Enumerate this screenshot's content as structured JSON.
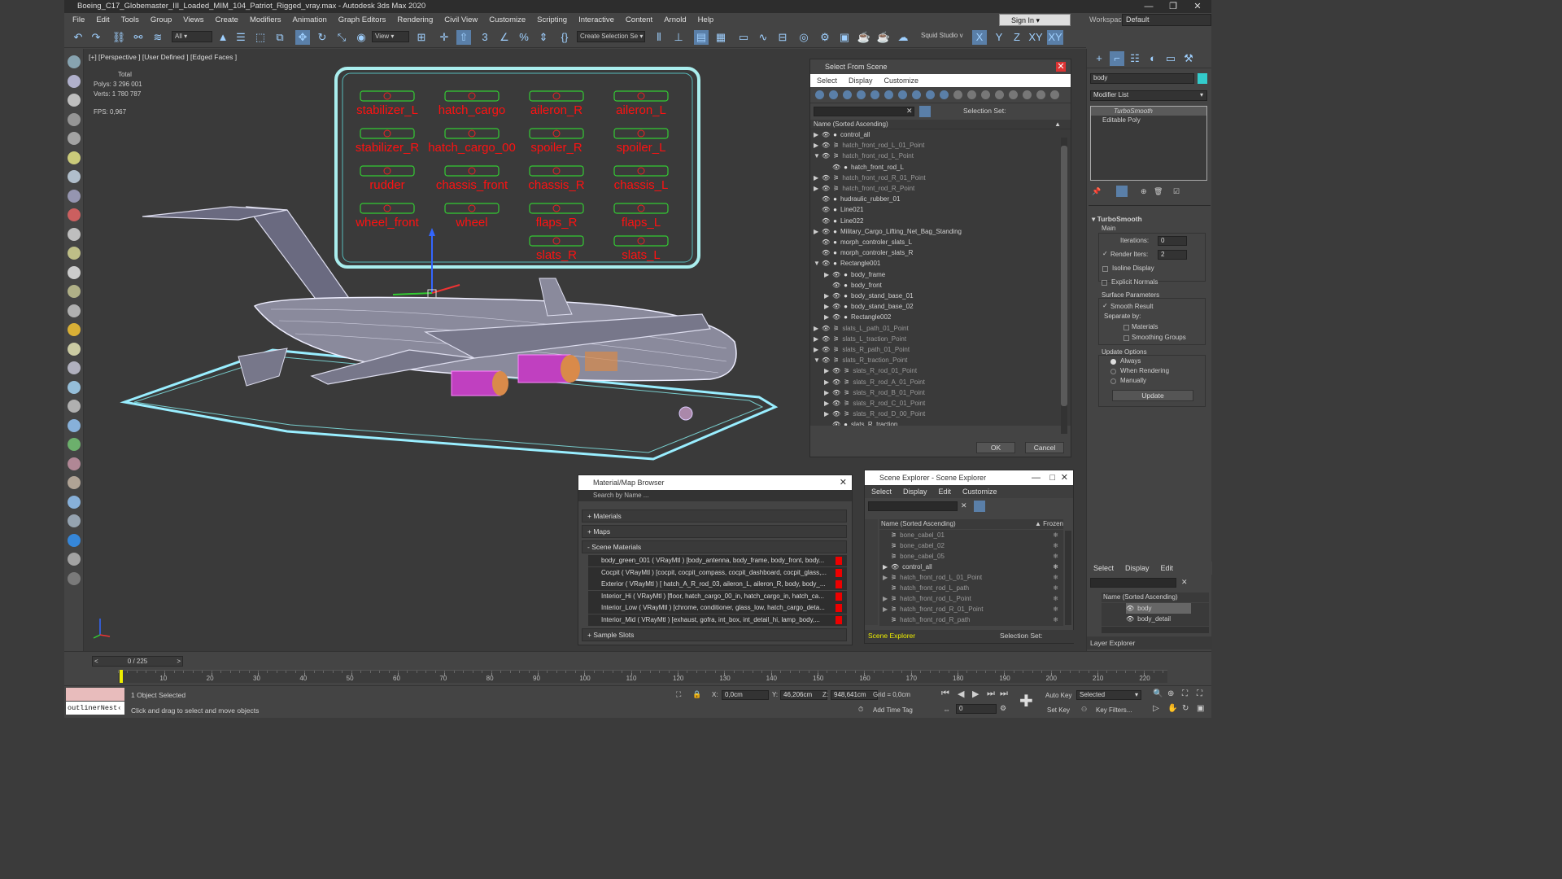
{
  "window": {
    "title": "Boeing_C17_Globemaster_III_Loaded_MIM_104_Patriot_Rigged_vray.max - Autodesk 3ds Max 2020",
    "min": "—",
    "max": "❐",
    "close": "✕"
  },
  "menu": [
    "File",
    "Edit",
    "Tools",
    "Group",
    "Views",
    "Create",
    "Modifiers",
    "Animation",
    "Graph Editors",
    "Rendering",
    "Civil View",
    "Customize",
    "Scripting",
    "Interactive",
    "Content",
    "Arnold",
    "Help"
  ],
  "signin": "Sign In",
  "workspace": {
    "label": "Workspaces:",
    "value": "Default"
  },
  "toolbar": {
    "filter": "All",
    "view": "View",
    "create_selection": "Create Selection Se",
    "squid": "Squid Studio v",
    "axes": [
      "X",
      "Y",
      "Z",
      "XY",
      "XY"
    ]
  },
  "viewport": {
    "label": "[+] [Perspective ] [User Defined ] [Edged Faces ]",
    "stats_total": "Total",
    "polys_label": "Polys:",
    "polys": "3 296 001",
    "verts_label": "Verts:",
    "verts": "1 780 787",
    "fps_label": "FPS:",
    "fps": "0,967",
    "controls": [
      "stabilizer_L",
      "hatch_cargo",
      "aileron_R",
      "aileron_L",
      "stabilizer_R",
      "hatch_cargo_00",
      "spoiler_R",
      "spoiler_L",
      "rudder",
      "chassis_front",
      "chassis_R",
      "chassis_L",
      "wheel_front",
      "wheel",
      "flaps_R",
      "flaps_L",
      "slats_R",
      "slats_L"
    ]
  },
  "select_scene": {
    "title": "Select From Scene",
    "menu": [
      "Select",
      "Display",
      "Customize"
    ],
    "selection_set": "Selection Set:",
    "column": "Name (Sorted Ascending)",
    "rows": [
      {
        "name": "control_all",
        "indent": 0,
        "exp": "▶",
        "dim": false
      },
      {
        "name": "hatch_front_rod_L_01_Point",
        "indent": 0,
        "exp": "▶",
        "dim": true
      },
      {
        "name": "hatch_front_rod_L_Point",
        "indent": 0,
        "exp": "▼",
        "dim": true
      },
      {
        "name": "hatch_front_rod_L",
        "indent": 1,
        "exp": "",
        "dim": false
      },
      {
        "name": "hatch_front_rod_R_01_Point",
        "indent": 0,
        "exp": "▶",
        "dim": true
      },
      {
        "name": "hatch_front_rod_R_Point",
        "indent": 0,
        "exp": "▶",
        "dim": true
      },
      {
        "name": "hudraulic_rubber_01",
        "indent": 0,
        "exp": "",
        "dim": false
      },
      {
        "name": "Line021",
        "indent": 0,
        "exp": "",
        "dim": false
      },
      {
        "name": "Line022",
        "indent": 0,
        "exp": "",
        "dim": false
      },
      {
        "name": "Military_Cargo_Lifting_Net_Bag_Standing",
        "indent": 0,
        "exp": "▶",
        "dim": false
      },
      {
        "name": "morph_controler_slats_L",
        "indent": 0,
        "exp": "",
        "dim": false
      },
      {
        "name": "morph_controler_slats_R",
        "indent": 0,
        "exp": "",
        "dim": false
      },
      {
        "name": "Rectangle001",
        "indent": 0,
        "exp": "▼",
        "dim": false
      },
      {
        "name": "body_frame",
        "indent": 1,
        "exp": "▶",
        "dim": false
      },
      {
        "name": "body_front",
        "indent": 1,
        "exp": "",
        "dim": false
      },
      {
        "name": "body_stand_base_01",
        "indent": 1,
        "exp": "▶",
        "dim": false
      },
      {
        "name": "body_stand_base_02",
        "indent": 1,
        "exp": "▶",
        "dim": false
      },
      {
        "name": "Rectangle002",
        "indent": 1,
        "exp": "▶",
        "dim": false
      },
      {
        "name": "slats_L_path_01_Point",
        "indent": 0,
        "exp": "▶",
        "dim": true
      },
      {
        "name": "slats_L_traction_Point",
        "indent": 0,
        "exp": "▶",
        "dim": true
      },
      {
        "name": "slats_R_path_01_Point",
        "indent": 0,
        "exp": "▶",
        "dim": true
      },
      {
        "name": "slats_R_traction_Point",
        "indent": 0,
        "exp": "▼",
        "dim": true
      },
      {
        "name": "slats_R_rod_01_Point",
        "indent": 1,
        "exp": "▶",
        "dim": true
      },
      {
        "name": "slats_R_rod_A_01_Point",
        "indent": 1,
        "exp": "▶",
        "dim": true
      },
      {
        "name": "slats_R_rod_B_01_Point",
        "indent": 1,
        "exp": "▶",
        "dim": true
      },
      {
        "name": "slats_R_rod_C_01_Point",
        "indent": 1,
        "exp": "▶",
        "dim": true
      },
      {
        "name": "slats_R_rod_D_00_Point",
        "indent": 1,
        "exp": "▶",
        "dim": true
      },
      {
        "name": "slats_R_traction",
        "indent": 1,
        "exp": "",
        "dim": false
      }
    ],
    "ok": "OK",
    "cancel": "Cancel"
  },
  "material_browser": {
    "title": "Material/Map Browser",
    "search": "Search by Name ...",
    "sections": [
      "+ Materials",
      "+ Maps",
      "- Scene Materials"
    ],
    "materials": [
      "body_green_001 ( VRayMtl ) [body_antenna, body_frame, body_front, body...",
      "Cocpit ( VRayMtl ) [cocpit, cocpit_compass, cocpit_dashboard, cocpit_glass,...",
      "Exterior ( VRayMtl ) [ hatch_A_R_rod_03, aileron_L, aileron_R, body, body_...",
      "Interior_Hi ( VRayMtl ) [floor, hatch_cargo_00_in, hatch_cargo_in, hatch_ca...",
      "Interior_Low ( VRayMtl ) [chrome, conditioner, glass_low, hatch_cargo_deta...",
      "Interior_Mid ( VRayMtl ) [exhaust, gofra, int_box, int_detail_hi, lamp_body,..."
    ],
    "sample_slots": "+ Sample Slots"
  },
  "scene_explorer": {
    "title": "Scene Explorer - Scene Explorer",
    "menu": [
      "Select",
      "Display",
      "Edit",
      "Customize"
    ],
    "column": "Name (Sorted Ascending)",
    "frozen": "▲ Frozen",
    "rows": [
      {
        "name": "bone_cabel_01",
        "exp": "",
        "dim": true
      },
      {
        "name": "bone_cabel_02",
        "exp": "",
        "dim": true
      },
      {
        "name": "bone_cabel_05",
        "exp": "",
        "dim": true
      },
      {
        "name": "control_all",
        "exp": "▶",
        "dim": false
      },
      {
        "name": "hatch_front_rod_L_01_Point",
        "exp": "▶",
        "dim": true
      },
      {
        "name": "hatch_front_rod_L_path",
        "exp": "",
        "dim": true
      },
      {
        "name": "hatch_front_rod_L_Point",
        "exp": "▶",
        "dim": true
      },
      {
        "name": "hatch_front_rod_R_01_Point",
        "exp": "▶",
        "dim": true
      },
      {
        "name": "hatch_front_rod_R_path",
        "exp": "",
        "dim": true
      }
    ],
    "footer": "Scene Explorer",
    "selection_set": "Selection Set:"
  },
  "command_panel": {
    "search": "body",
    "modifier_list": "Modifier List",
    "stack": [
      "TurboSmooth",
      "Editable Poly"
    ],
    "rollout": "TurboSmooth",
    "main": "Main",
    "iterations_label": "Iterations:",
    "iterations": "0",
    "render_iters_label": "Render Iters:",
    "render_iters": "2",
    "isoline": "Isoline Display",
    "explicit": "Explicit Normals",
    "surface": "Surface Parameters",
    "smooth": "Smooth Result",
    "separate": "Separate by:",
    "materials": "Materials",
    "smoothing": "Smoothing Groups",
    "update_options": "Update Options",
    "always": "Always",
    "when_rendering": "When Rendering",
    "manually": "Manually",
    "update": "Update"
  },
  "layer_explorer": {
    "menu": [
      "Select",
      "Display",
      "Edit"
    ],
    "column": "Name (Sorted Ascending)",
    "rows": [
      "body",
      "body_detail"
    ],
    "footer": "Layer Explorer"
  },
  "timeline": {
    "frame": "0 / 225",
    "ticks": [
      "10",
      "20",
      "30",
      "40",
      "50",
      "60",
      "70",
      "80",
      "90",
      "100",
      "110",
      "120",
      "130",
      "140",
      "150",
      "160",
      "170",
      "180",
      "190",
      "200",
      "210",
      "220"
    ]
  },
  "status": {
    "script": "outlinerNest‹",
    "selected": "1 Object Selected",
    "hint": "Click and drag to select and move objects",
    "x_label": "X:",
    "x": "0,0cm",
    "y_label": "Y:",
    "y": "46,206cm",
    "z_label": "Z:",
    "z": "948,641cm",
    "grid": "Grid = 0,0cm",
    "add_time_tag": "Add Time Tag",
    "auto_key": "Auto Key",
    "set_key": "Set Key",
    "key_mode": "Selected",
    "key_filters": "Key Filters...",
    "frame_field": "0"
  }
}
